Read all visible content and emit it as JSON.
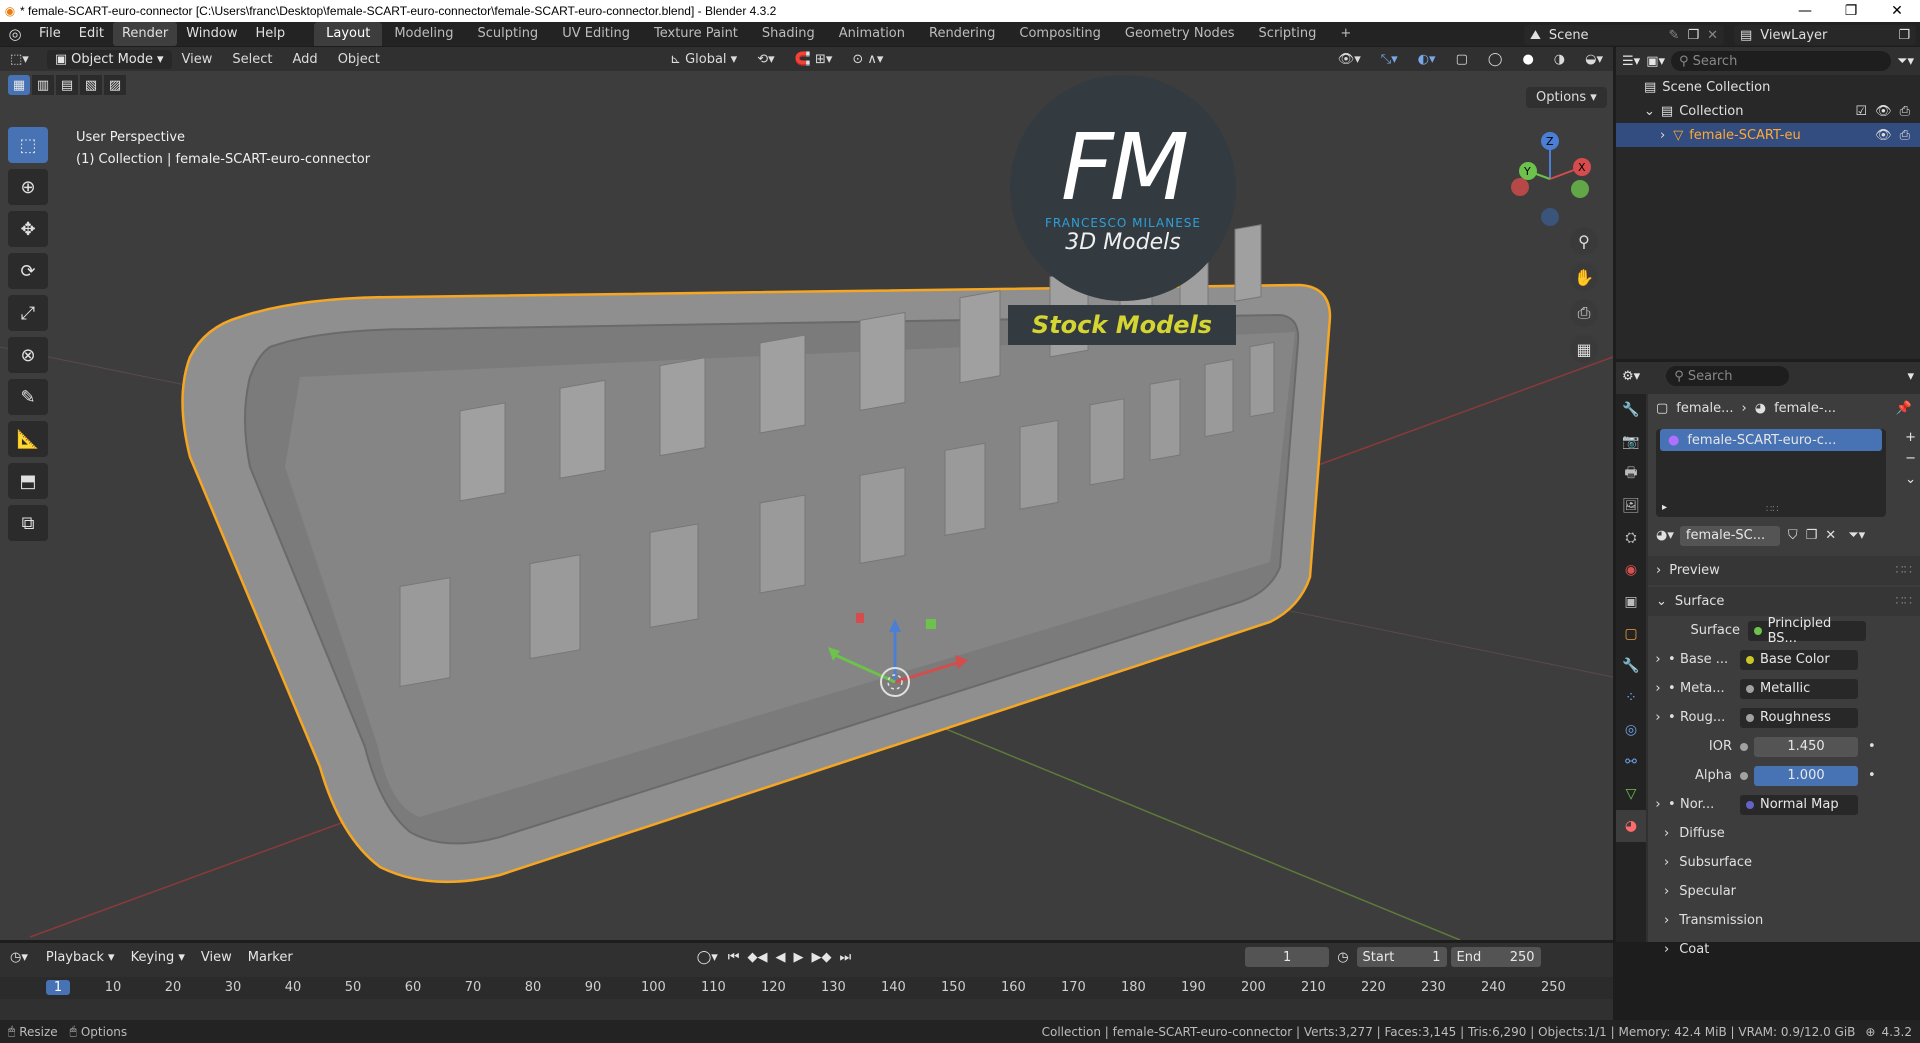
{
  "window": {
    "title": "* female-SCART-euro-connector [C:\\Users\\franc\\Desktop\\female-SCART-euro-connector\\female-SCART-euro-connector.blend] - Blender 4.3.2"
  },
  "menu": [
    "File",
    "Edit",
    "Render",
    "Window",
    "Help"
  ],
  "workspaces": [
    "Layout",
    "Modeling",
    "Sculpting",
    "UV Editing",
    "Texture Paint",
    "Shading",
    "Animation",
    "Rendering",
    "Compositing",
    "Geometry Nodes",
    "Scripting"
  ],
  "scene": "Scene",
  "view_layer": "ViewLayer",
  "viewport": {
    "mode": "Object Mode",
    "menus": [
      "View",
      "Select",
      "Add",
      "Object"
    ],
    "transform_orientation": "Global",
    "options_label": "Options",
    "info_line1": "User Perspective",
    "info_line2": "(1) Collection | female-SCART-euro-connector",
    "gizmo_axes": [
      "Z",
      "Y",
      "X"
    ]
  },
  "watermark": {
    "logo": "FM",
    "name": "FRANCESCO MILANESE",
    "tagline": "3D Models",
    "badge": "Stock Models"
  },
  "outliner": {
    "search_placeholder": "Search",
    "scene_collection": "Scene Collection",
    "collection": "Collection",
    "object": "female-SCART-eu"
  },
  "properties": {
    "search_placeholder": "Search",
    "breadcrumb_object": "female...",
    "breadcrumb_material": "female-...",
    "material_slot": "female-SCART-euro-c...",
    "material_name": "female-SC...",
    "sections": {
      "preview": "Preview",
      "surface": "Surface"
    },
    "surface_label": "Surface",
    "surface_shader": "Principled BS...",
    "inputs": [
      {
        "label": "Base ...",
        "value": "Base Color",
        "color": "#c7c729"
      },
      {
        "label": "Meta...",
        "value": "Metallic",
        "color": "#a1a1a1"
      },
      {
        "label": "Roug...",
        "value": "Roughness",
        "color": "#a1a1a1"
      }
    ],
    "ior_label": "IOR",
    "ior_value": "1.450",
    "alpha_label": "Alpha",
    "alpha_value": "1.000",
    "normal_label": "Nor...",
    "normal_value": "Normal Map",
    "subsections": [
      "Diffuse",
      "Subsurface",
      "Specular",
      "Transmission",
      "Coat"
    ]
  },
  "timeline": {
    "menus": [
      "Playback",
      "Keying",
      "View",
      "Marker"
    ],
    "current_frame": "1",
    "start_label": "Start",
    "start_value": "1",
    "end_label": "End",
    "end_value": "250",
    "frame_ticks": [
      "1",
      "10",
      "20",
      "30",
      "40",
      "50",
      "60",
      "70",
      "80",
      "90",
      "100",
      "110",
      "120",
      "130",
      "140",
      "150",
      "160",
      "170",
      "180",
      "190",
      "200",
      "210",
      "220",
      "230",
      "240",
      "250"
    ]
  },
  "status": {
    "left_resize": "Resize",
    "left_options": "Options",
    "info": "Collection | female-SCART-euro-connector | Verts:3,277 | Faces:3,145 | Tris:6,290 | Objects:1/1 | Memory: 42.4 MiB | VRAM: 0.9/12.0 GiB",
    "version": "4.3.2"
  },
  "colors": {
    "accent": "#4772b3",
    "selection_outline": "#f5a623",
    "watermark_blue": "#2e9fd8",
    "badge_text": "#d4d432"
  }
}
